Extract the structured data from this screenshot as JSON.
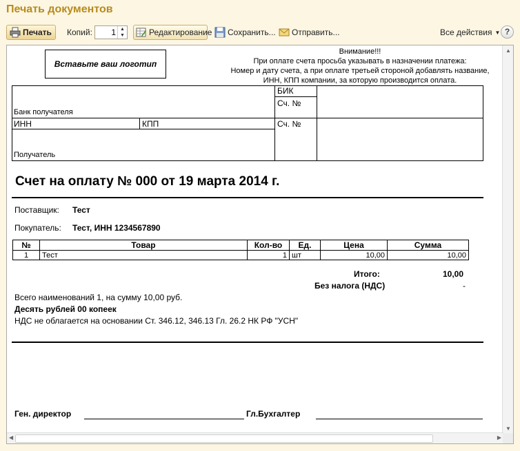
{
  "window": {
    "title": "Печать документов"
  },
  "toolbar": {
    "print_label": "Печать",
    "copies_label": "Копий:",
    "copies_value": "1",
    "edit_label": "Редактирование",
    "save_label": "Сохранить...",
    "send_label": "Отправить...",
    "all_actions_label": "Все действия",
    "help_label": "?"
  },
  "document": {
    "logo_placeholder": "Вставьте ваш логотип",
    "notice": {
      "title": "Внимание!!!",
      "line1": "При оплате счета просьба указывать в назначении платежа:",
      "line2": "Номер и дату счета, а при оплате третьей стороной добавлять название,",
      "line3": "ИНН, КПП компании, за которую производится оплата."
    },
    "bank": {
      "bank_label": "Банк получателя",
      "bik_label": "БИК",
      "account_label_1": "Сч. №",
      "inn_label": "ИНН",
      "kpp_label": "КПП",
      "account_label_2": "Сч. №",
      "recipient_label": "Получатель"
    },
    "heading": "Счет на оплату № 000 от 19 марта 2014 г.",
    "supplier_label": "Поставщик:",
    "supplier_value": "Тест",
    "buyer_label": "Покупатель:",
    "buyer_value": "Тест,  ИНН 1234567890",
    "table": {
      "headers": [
        "№",
        "Товар",
        "Кол-во",
        "Ед.",
        "Цена",
        "Сумма"
      ],
      "rows": [
        [
          "1",
          "Тест",
          "1",
          "шт",
          "10,00",
          "10,00"
        ]
      ]
    },
    "totals": {
      "total_label": "Итого:",
      "total_value": "10,00",
      "vat_label": "Без налога (НДС)",
      "vat_value": "-"
    },
    "summary_line": "Всего наименований 1, на сумму 10,00 руб.",
    "amount_words": "Десять рублей 00 копеек",
    "vat_note": "НДС не облагается на основании Ст. 346.12, 346.13 Гл. 26.2 НК РФ \"УСН\"",
    "director_label": "Ген. директор",
    "accountant_label": "Гл.Бухгалтер"
  }
}
